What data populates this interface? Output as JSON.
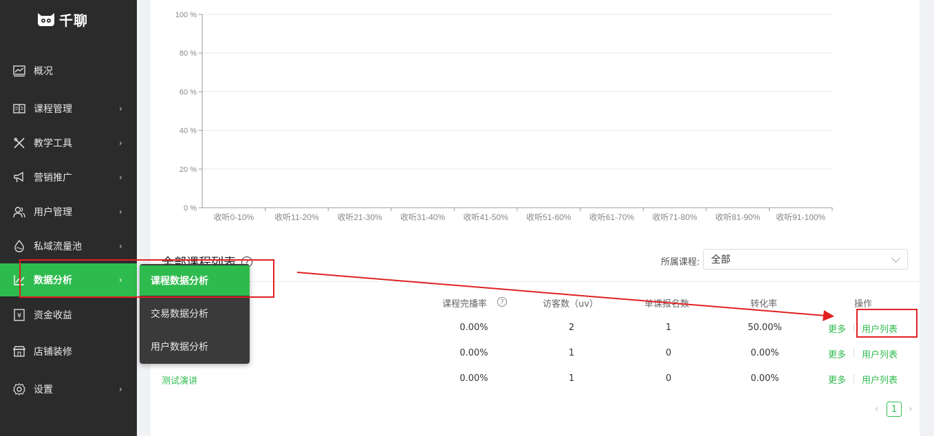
{
  "app": {
    "logo_text": "千聊"
  },
  "sidebar": {
    "items": [
      {
        "label": "概况",
        "icon": "chart-line-icon",
        "has_children": false
      },
      {
        "label": "课程管理",
        "icon": "book-open-icon",
        "has_children": true
      },
      {
        "label": "教学工具",
        "icon": "tools-icon",
        "has_children": true
      },
      {
        "label": "营销推广",
        "icon": "megaphone-icon",
        "has_children": true
      },
      {
        "label": "用户管理",
        "icon": "users-icon",
        "has_children": true
      },
      {
        "label": "私域流量池",
        "icon": "droplet-icon",
        "has_children": true
      },
      {
        "label": "数据分析",
        "icon": "analytics-icon",
        "has_children": true,
        "active": true
      },
      {
        "label": "资金收益",
        "icon": "yen-icon",
        "has_children": false
      },
      {
        "label": "店铺装修",
        "icon": "store-icon",
        "has_children": false
      },
      {
        "label": "设置",
        "icon": "gear-icon",
        "has_children": true
      }
    ],
    "submenu": [
      {
        "label": "课程数据分析",
        "active": true
      },
      {
        "label": "交易数据分析",
        "active": false
      },
      {
        "label": "用户数据分析",
        "active": false
      }
    ]
  },
  "chart_data": {
    "type": "bar",
    "categories": [
      "收听0-10%",
      "收听11-20%",
      "收听21-30%",
      "收听31-40%",
      "收听41-50%",
      "收听51-60%",
      "收听61-70%",
      "收听71-80%",
      "收听81-90%",
      "收听91-100%"
    ],
    "values": [
      0,
      0,
      0,
      0,
      0,
      0,
      0,
      0,
      0,
      0
    ],
    "y_ticks": [
      "0 %",
      "20 %",
      "40 %",
      "60 %",
      "80 %",
      "100 %"
    ],
    "ylim": [
      0,
      100
    ],
    "grid": true
  },
  "course_list": {
    "title": "全部课程列表",
    "help_icon": "?",
    "filter_label": "所属课程:",
    "filter_value": "全部",
    "columns": [
      "课程完播率",
      "访客数（uv）",
      "单课报名数",
      "转化率",
      "操作"
    ],
    "col_help": "?",
    "rows": [
      {
        "name": "",
        "completion": "0.00%",
        "visitors": "2",
        "signups": "1",
        "conversion": "50.00%"
      },
      {
        "name": "",
        "completion": "0.00%",
        "visitors": "1",
        "signups": "0",
        "conversion": "0.00%"
      },
      {
        "name": "测试演讲",
        "completion": "0.00%",
        "visitors": "1",
        "signups": "0",
        "conversion": "0.00%"
      }
    ],
    "action_more": "更多",
    "action_users": "用户列表"
  },
  "pagination": {
    "current": "1",
    "prev": "‹",
    "next": "›"
  },
  "colors": {
    "accent": "#2ebb4e",
    "sidebar_bg": "#2b2b2b",
    "annotation": "#e02020"
  }
}
